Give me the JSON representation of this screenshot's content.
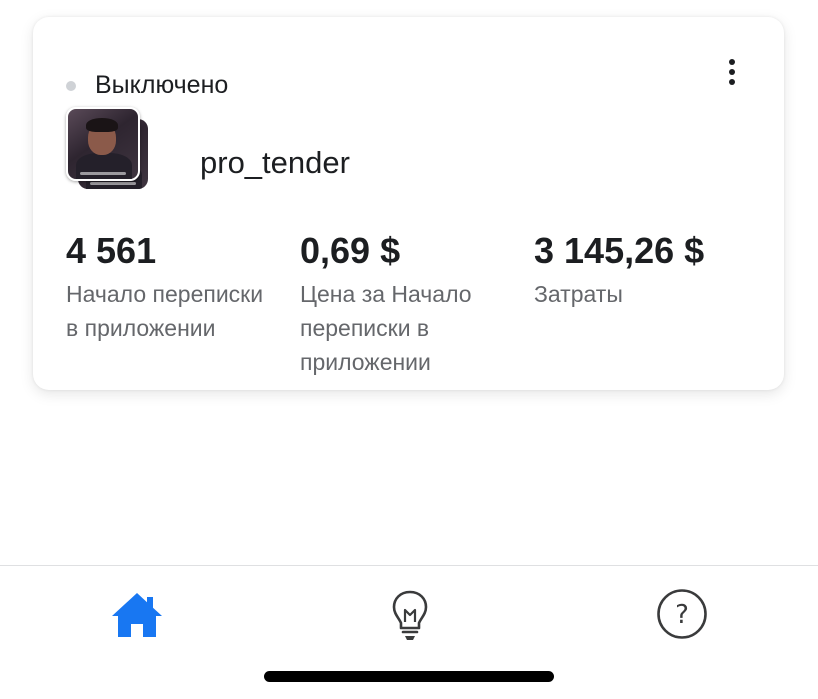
{
  "card": {
    "status": {
      "label": "Выключено",
      "dot_color": "#cfd2d6"
    },
    "menu_icon": "more-vertical-icon",
    "account": {
      "name": "pro_tender",
      "avatar": "profile-photo"
    },
    "metrics": [
      {
        "value": "4 561",
        "label": "Начало переписки в приложении"
      },
      {
        "value": "0,69 $",
        "label": "Цена за Начало переписки в приложении"
      },
      {
        "value": "3 145,26 $",
        "label": "Затраты"
      }
    ]
  },
  "tabbar": {
    "tabs": [
      {
        "icon": "home-icon",
        "active": true
      },
      {
        "icon": "lightbulb-icon",
        "active": false
      },
      {
        "icon": "help-icon",
        "active": false
      }
    ],
    "active_color": "#1877f2",
    "inactive_color": "#3a3b3c"
  }
}
